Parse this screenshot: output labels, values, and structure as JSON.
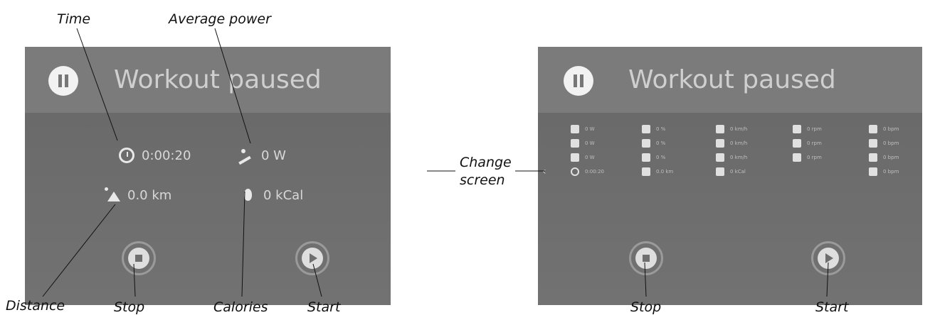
{
  "screen1": {
    "title": "Workout paused",
    "stats": {
      "time": "0:00:20",
      "power": "0 W",
      "distance": "0.0 km",
      "calories": "0 kCal"
    },
    "icons": [
      "pause-icon",
      "clock-icon",
      "power-icon",
      "distance-icon",
      "calories-icon",
      "stop-icon",
      "play-icon"
    ]
  },
  "screen2": {
    "title": "Workout paused",
    "grid": {
      "col1": [
        "0 W",
        "0 W",
        "0 W",
        "0:00:20"
      ],
      "col2": [
        "0 %",
        "0 %",
        "0 %",
        "0.0 km"
      ],
      "col3": [
        "0 km/h",
        "0 km/h",
        "0 km/h",
        "0 kCal"
      ],
      "col4": [
        "0 rpm",
        "0 rpm",
        "0 rpm"
      ],
      "col5": [
        "0 bpm",
        "0 bpm",
        "0 bpm",
        "0 bpm"
      ]
    }
  },
  "callouts": {
    "time": "Time",
    "average_power": "Average power",
    "change_screen_1": "Change",
    "change_screen_2": "screen",
    "distance": "Distance",
    "stop_left": "Stop",
    "calories": "Calories",
    "start_left": "Start",
    "stop_right": "Stop",
    "start_right": "Start"
  }
}
